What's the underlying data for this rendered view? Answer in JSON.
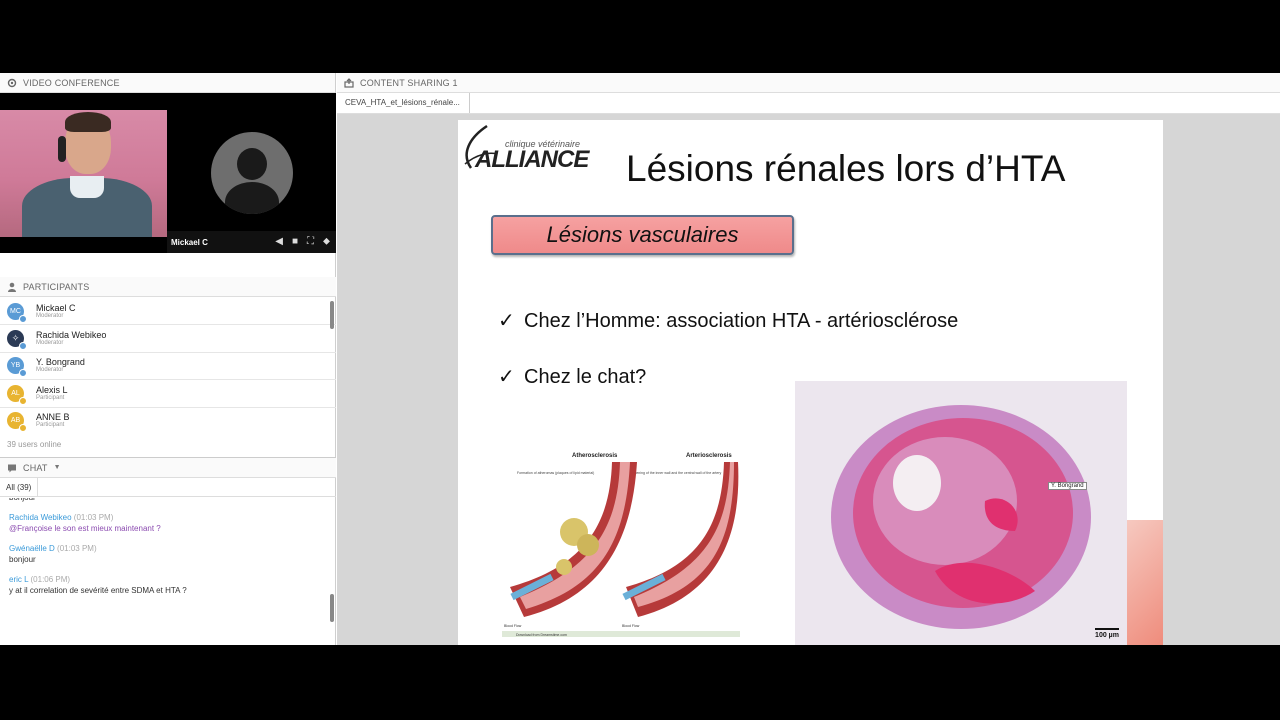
{
  "video_panel": {
    "title": "VIDEO CONFERENCE",
    "tile_name": "Mickael C"
  },
  "participants_panel": {
    "title": "PARTICIPANTS",
    "list": [
      {
        "initials": "MC",
        "name": "Mickael C",
        "role": "Moderator",
        "color": "#5a9bd5"
      },
      {
        "initials": "",
        "name": "Rachida Webikeo",
        "role": "Moderator",
        "color": "#2b3a55"
      },
      {
        "initials": "YB",
        "name": "Y. Bongrand",
        "role": "Moderator",
        "color": "#5a9bd5"
      },
      {
        "initials": "AL",
        "name": "Alexis L",
        "role": "Participant",
        "color": "#e8b431"
      },
      {
        "initials": "AB",
        "name": "ANNE B",
        "role": "Participant",
        "color": "#e8b431"
      }
    ],
    "online": "39 users online"
  },
  "chat_panel": {
    "title": "CHAT",
    "tab_all": "All (39)",
    "messages": [
      {
        "author": "",
        "time": "",
        "text": "bonjour"
      },
      {
        "author": "Rachida Webikeo",
        "time": "(01:03 PM)",
        "text": "@Françoise le son est mieux maintenant  ?"
      },
      {
        "author": "Gwénaëlle D",
        "time": "(01:03 PM)",
        "text": "bonjour"
      },
      {
        "author": "eric L",
        "time": "(01:06 PM)",
        "text": "y at il correlation de sevérité entre SDMA et HTA ?"
      }
    ]
  },
  "content_panel": {
    "title": "CONTENT SHARING 1",
    "file_tab": "CEVA_HTA_et_lésions_rénale..."
  },
  "slide": {
    "logo_small": "clinique vétérinaire",
    "logo_big": "ALLIANCE",
    "title": "Lésions rénales lors d’HTA",
    "subtitle": "Lésions vasculaires",
    "bullet1": "Chez l’Homme: association HTA - artériosclérose",
    "bullet2": "Chez le chat?",
    "check": "✓",
    "diagram": {
      "label_left": "Atherosclerosis",
      "label_right": "Arteriosclerosis",
      "note_left": "Formation of atheromas (plaques of lipid material)",
      "note_right": "Thickening of the inner wall and the central wall of the artery",
      "flow_left": "Blood Flow",
      "flow_right": "Blood Flow",
      "download": "Download from Dreamstime.com"
    },
    "scale_label": "100 µm",
    "cursor_label": "Y. Bongrand"
  }
}
